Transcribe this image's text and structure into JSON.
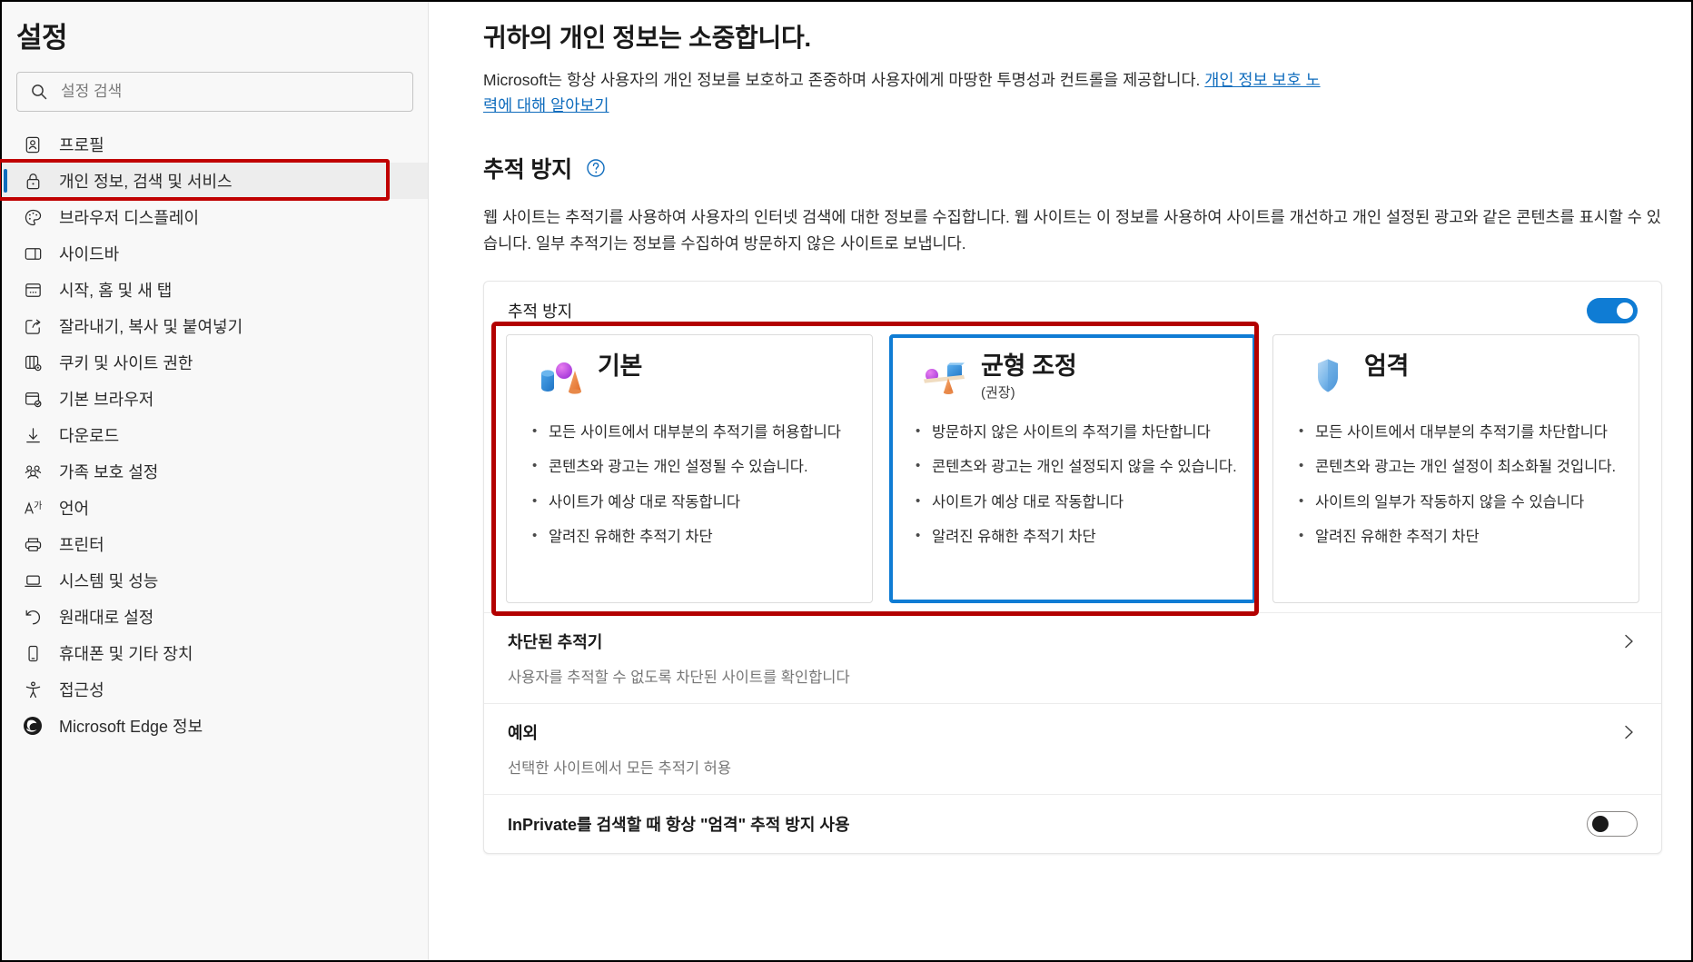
{
  "sidebar": {
    "title": "설정",
    "search": {
      "placeholder": "설정 검색",
      "value": "",
      "icon": "search-icon"
    },
    "items": [
      {
        "label": "프로필",
        "icon": "profile-icon",
        "selected": false
      },
      {
        "label": "개인 정보, 검색 및 서비스",
        "icon": "lock-icon",
        "selected": true
      },
      {
        "label": "브라우저 디스플레이",
        "icon": "palette-icon",
        "selected": false
      },
      {
        "label": "사이드바",
        "icon": "sidebar-icon",
        "selected": false
      },
      {
        "label": "시작, 홈 및 새 탭",
        "icon": "window-tabs-icon",
        "selected": false
      },
      {
        "label": "잘라내기, 복사 및 붙여넣기",
        "icon": "share-icon",
        "selected": false
      },
      {
        "label": "쿠키 및 사이트 권한",
        "icon": "cookie-settings-icon",
        "selected": false
      },
      {
        "label": "기본 브라우저",
        "icon": "default-browser-icon",
        "selected": false
      },
      {
        "label": "다운로드",
        "icon": "download-icon",
        "selected": false
      },
      {
        "label": "가족 보호 설정",
        "icon": "family-icon",
        "selected": false
      },
      {
        "label": "언어",
        "icon": "language-icon",
        "selected": false
      },
      {
        "label": "프린터",
        "icon": "printer-icon",
        "selected": false
      },
      {
        "label": "시스템 및 성능",
        "icon": "laptop-icon",
        "selected": false
      },
      {
        "label": "원래대로 설정",
        "icon": "reset-icon",
        "selected": false
      },
      {
        "label": "휴대폰 및 기타 장치",
        "icon": "phone-icon",
        "selected": false
      },
      {
        "label": "접근성",
        "icon": "accessibility-icon",
        "selected": false
      },
      {
        "label": "Microsoft Edge 정보",
        "icon": "edge-logo-icon",
        "selected": false
      }
    ]
  },
  "main": {
    "privacy_heading": "귀하의 개인 정보는 소중합니다.",
    "privacy_desc_1": "Microsoft는 항상 사용자의 개인 정보를 보호하고 존중하며 사용자에게 마땅한 투명성과 컨트롤을 제공합니다. ",
    "privacy_link": "개인 정보 보호 노력에 대해 알아보기",
    "section_title": "추적 방지",
    "section_help_icon": "question-circle-icon",
    "section_desc": "웹 사이트는 추적기를 사용하여 사용자의 인터넷 검색에 대한 정보를 수집합니다. 웹 사이트는 이 정보를 사용하여 사이트를 개선하고 개인 설정된 광고와 같은 콘텐츠를 표시할 수 있습니다. 일부 추적기는 정보를 수집하여 방문하지 않은 사이트로 보냅니다.",
    "panel_toggle_label": "추적 방지",
    "panel_toggle_state": "on",
    "cards": [
      {
        "title": "기본",
        "subtitle": "",
        "icon": "shapes-basic-icon",
        "selected": false,
        "bullets": [
          "모든 사이트에서 대부분의 추적기를 허용합니다",
          "콘텐츠와 광고는 개인 설정될 수 있습니다.",
          "사이트가 예상 대로 작동합니다",
          "알려진 유해한 추적기 차단"
        ]
      },
      {
        "title": "균형 조정",
        "subtitle": "(권장)",
        "icon": "balance-scale-icon",
        "selected": true,
        "bullets": [
          "방문하지 않은 사이트의 추적기를 차단합니다",
          "콘텐츠와 광고는 개인 설정되지 않을 수 있습니다.",
          "사이트가 예상 대로 작동합니다",
          "알려진 유해한 추적기 차단"
        ]
      },
      {
        "title": "엄격",
        "subtitle": "",
        "icon": "shield-icon",
        "selected": false,
        "bullets": [
          "모든 사이트에서 대부분의 추적기를 차단합니다",
          "콘텐츠와 광고는 개인 설정이 최소화될 것입니다.",
          "사이트의 일부가 작동하지 않을 수 있습니다",
          "알려진 유해한 추적기 차단"
        ]
      }
    ],
    "rows": [
      {
        "title": "차단된 추적기",
        "sub": "사용자를 추적할 수 없도록 차단된 사이트를 확인합니다",
        "control": "chevron"
      },
      {
        "title": "예외",
        "sub": "선택한 사이트에서 모든 추적기 허용",
        "control": "chevron"
      },
      {
        "title": "InPrivate를 검색할 때 항상 \"엄격\" 추적 방지 사용",
        "sub": "",
        "control": "toggle-off"
      }
    ]
  },
  "colors": {
    "accent": "#0f6cbd",
    "toggle_on": "#0f7cd4",
    "annotation_red": "#b30000",
    "sidebar_bg": "#f8f8f8",
    "selected_row_bg": "#ededed"
  }
}
